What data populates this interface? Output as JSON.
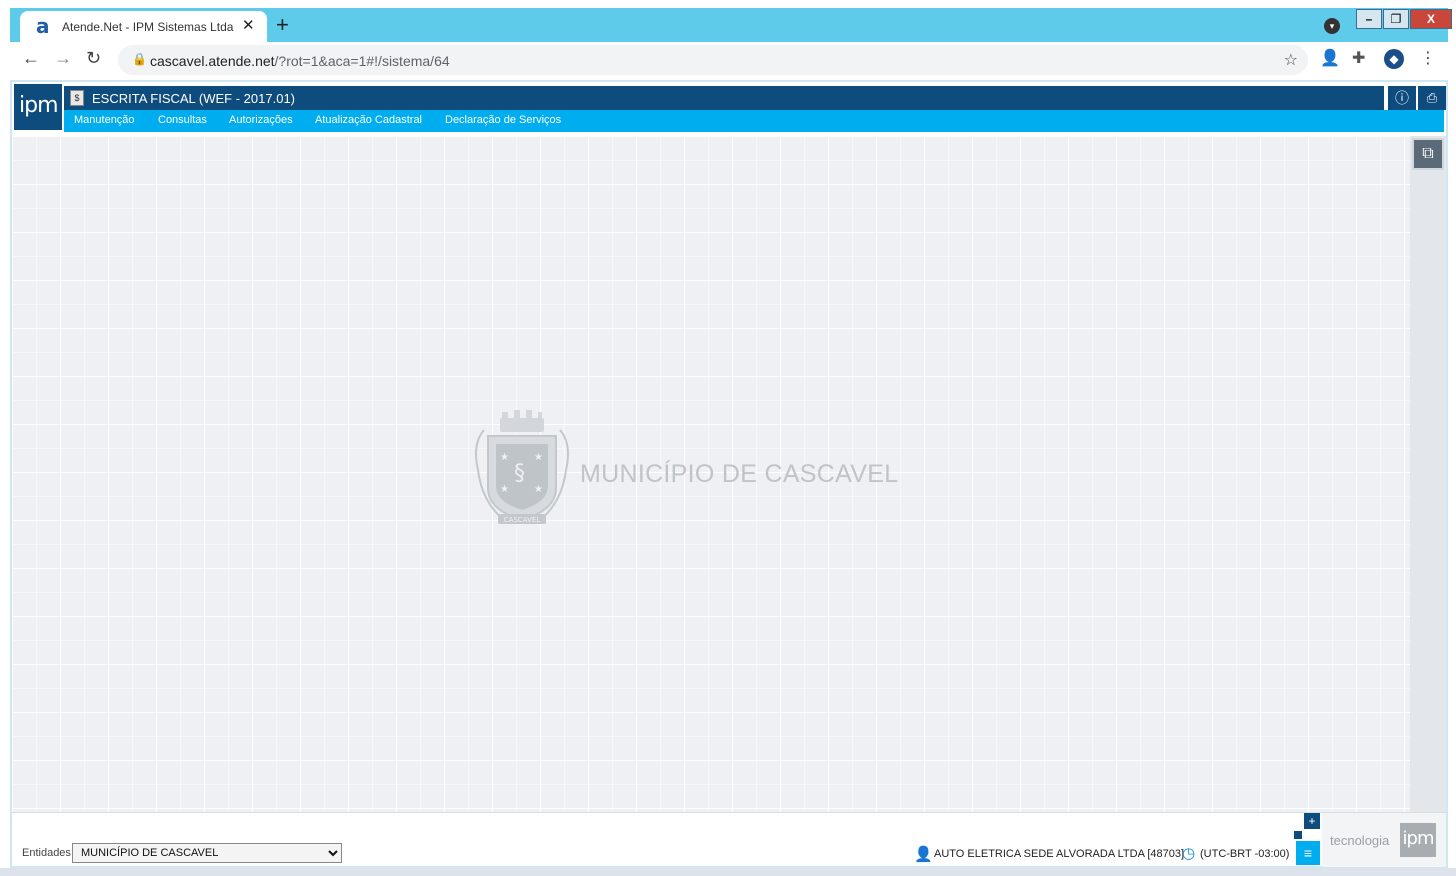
{
  "browser": {
    "tab_title": "Atende.Net - IPM Sistemas Ltda",
    "favicon_glyph": "a",
    "close_glyph": "✕",
    "newtab_glyph": "+",
    "url_host": "cascavel.atende.net",
    "url_path": "/?rot=1&aca=1#!/sistema/64",
    "accent_color": "#5fcbea",
    "window_buttons": {
      "minimize": "–",
      "maximize": "❐",
      "close": "X"
    },
    "icons": [
      "back-arrow-icon",
      "forward-arrow-icon",
      "reload-icon",
      "lock-icon",
      "star-icon",
      "profile-icon",
      "extensions-icon",
      "ipm-extension-icon",
      "menu-dots-icon"
    ]
  },
  "app": {
    "logo_text": "ipm",
    "system_title": "ESCRITA FISCAL (WEF - 2017.01)",
    "menu": [
      {
        "label": "Manutenção"
      },
      {
        "label": "Consultas"
      },
      {
        "label": "Autorizações"
      },
      {
        "label": "Atualização Cadastral"
      },
      {
        "label": "Declaração de Serviços"
      }
    ],
    "colors": {
      "dark_blue": "#0f4c7e",
      "light_blue": "#00aeef"
    }
  },
  "workspace": {
    "municipio_name": "MUNICÍPIO DE CASCAVEL",
    "crest_label": "CASCAVEL"
  },
  "footer": {
    "entidades_label": "Entidades",
    "entidades_selected": "MUNICÍPIO DE CASCAVEL",
    "user": "AUTO ELETRICA SEDE ALVORADA LTDA [48703]",
    "timezone": "(UTC-BRT -03:00)",
    "brand_text": "tecnologia",
    "brand_logo": "ipm"
  }
}
